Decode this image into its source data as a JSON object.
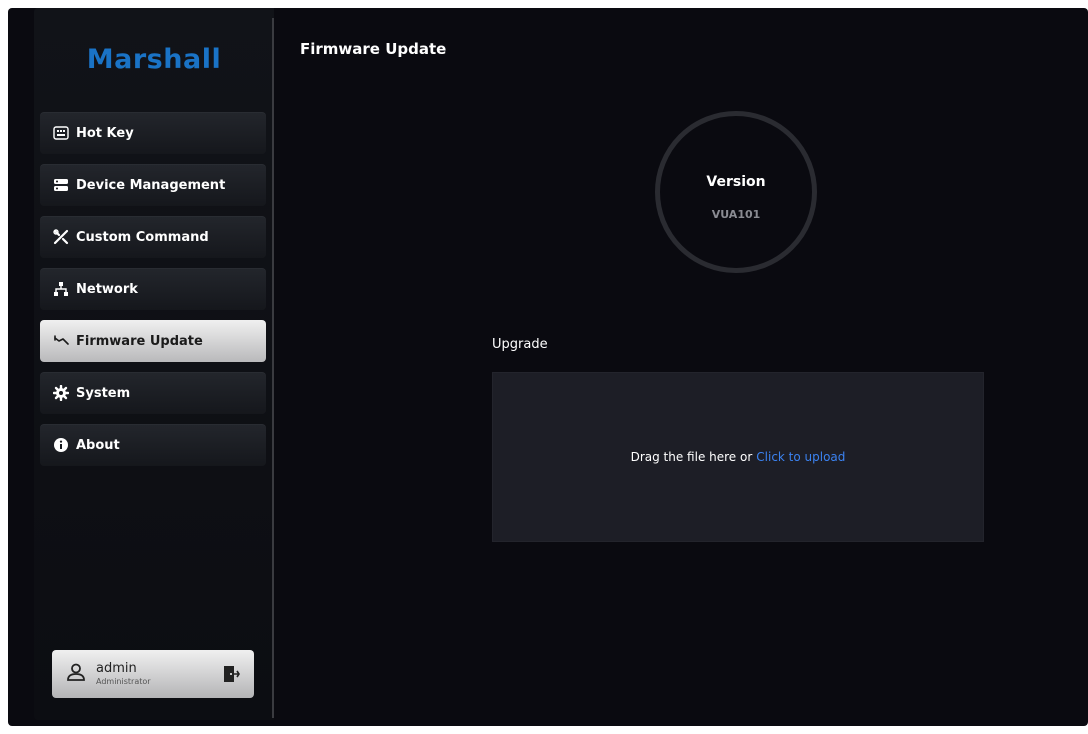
{
  "sidebar": {
    "logo": "Marshall",
    "items": [
      {
        "label": "Hot Key",
        "icon": "keyboard-icon"
      },
      {
        "label": "Device Management",
        "icon": "server-icon"
      },
      {
        "label": "Custom Command",
        "icon": "tools-icon"
      },
      {
        "label": "Network",
        "icon": "network-icon"
      },
      {
        "label": "Firmware Update",
        "icon": "wrench-icon",
        "active": true
      },
      {
        "label": "System",
        "icon": "gear-icon"
      },
      {
        "label": "About",
        "icon": "info-icon"
      }
    ],
    "user": {
      "name": "admin",
      "role": "Administrator",
      "logout_icon": "logout-icon"
    }
  },
  "main": {
    "title": "Firmware Update",
    "version": {
      "label": "Version",
      "value": "VUA101"
    },
    "upgrade": {
      "label": "Upgrade",
      "drop_text": "Drag the file here or",
      "upload_link": "Click to upload"
    }
  },
  "colors": {
    "background": "#0a0a10",
    "brand": "#1a73c6",
    "link": "#3b82f0",
    "active_item": "#d9d9db"
  }
}
